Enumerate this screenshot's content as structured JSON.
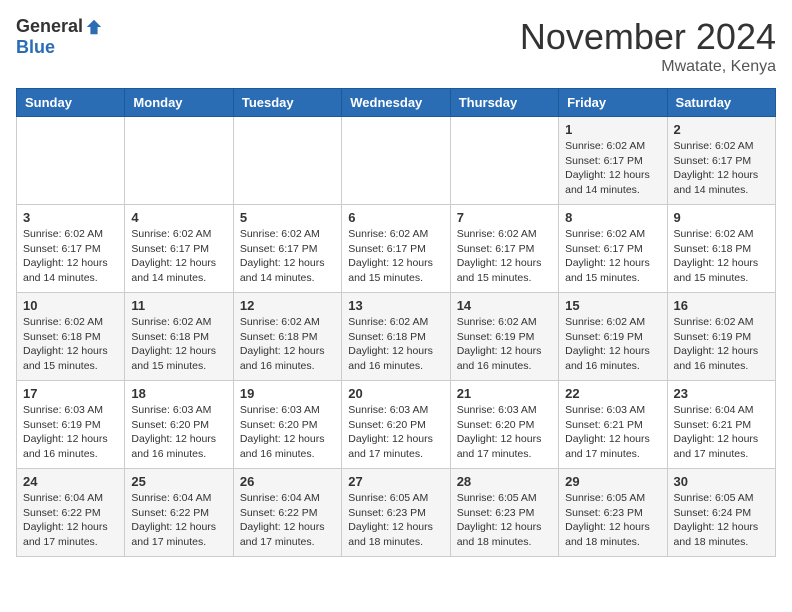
{
  "header": {
    "logo_general": "General",
    "logo_blue": "Blue",
    "month_title": "November 2024",
    "location": "Mwatate, Kenya"
  },
  "days_of_week": [
    "Sunday",
    "Monday",
    "Tuesday",
    "Wednesday",
    "Thursday",
    "Friday",
    "Saturday"
  ],
  "weeks": [
    [
      {
        "day": "",
        "info": ""
      },
      {
        "day": "",
        "info": ""
      },
      {
        "day": "",
        "info": ""
      },
      {
        "day": "",
        "info": ""
      },
      {
        "day": "",
        "info": ""
      },
      {
        "day": "1",
        "info": "Sunrise: 6:02 AM\nSunset: 6:17 PM\nDaylight: 12 hours\nand 14 minutes."
      },
      {
        "day": "2",
        "info": "Sunrise: 6:02 AM\nSunset: 6:17 PM\nDaylight: 12 hours\nand 14 minutes."
      }
    ],
    [
      {
        "day": "3",
        "info": "Sunrise: 6:02 AM\nSunset: 6:17 PM\nDaylight: 12 hours\nand 14 minutes."
      },
      {
        "day": "4",
        "info": "Sunrise: 6:02 AM\nSunset: 6:17 PM\nDaylight: 12 hours\nand 14 minutes."
      },
      {
        "day": "5",
        "info": "Sunrise: 6:02 AM\nSunset: 6:17 PM\nDaylight: 12 hours\nand 14 minutes."
      },
      {
        "day": "6",
        "info": "Sunrise: 6:02 AM\nSunset: 6:17 PM\nDaylight: 12 hours\nand 15 minutes."
      },
      {
        "day": "7",
        "info": "Sunrise: 6:02 AM\nSunset: 6:17 PM\nDaylight: 12 hours\nand 15 minutes."
      },
      {
        "day": "8",
        "info": "Sunrise: 6:02 AM\nSunset: 6:17 PM\nDaylight: 12 hours\nand 15 minutes."
      },
      {
        "day": "9",
        "info": "Sunrise: 6:02 AM\nSunset: 6:18 PM\nDaylight: 12 hours\nand 15 minutes."
      }
    ],
    [
      {
        "day": "10",
        "info": "Sunrise: 6:02 AM\nSunset: 6:18 PM\nDaylight: 12 hours\nand 15 minutes."
      },
      {
        "day": "11",
        "info": "Sunrise: 6:02 AM\nSunset: 6:18 PM\nDaylight: 12 hours\nand 15 minutes."
      },
      {
        "day": "12",
        "info": "Sunrise: 6:02 AM\nSunset: 6:18 PM\nDaylight: 12 hours\nand 16 minutes."
      },
      {
        "day": "13",
        "info": "Sunrise: 6:02 AM\nSunset: 6:18 PM\nDaylight: 12 hours\nand 16 minutes."
      },
      {
        "day": "14",
        "info": "Sunrise: 6:02 AM\nSunset: 6:19 PM\nDaylight: 12 hours\nand 16 minutes."
      },
      {
        "day": "15",
        "info": "Sunrise: 6:02 AM\nSunset: 6:19 PM\nDaylight: 12 hours\nand 16 minutes."
      },
      {
        "day": "16",
        "info": "Sunrise: 6:02 AM\nSunset: 6:19 PM\nDaylight: 12 hours\nand 16 minutes."
      }
    ],
    [
      {
        "day": "17",
        "info": "Sunrise: 6:03 AM\nSunset: 6:19 PM\nDaylight: 12 hours\nand 16 minutes."
      },
      {
        "day": "18",
        "info": "Sunrise: 6:03 AM\nSunset: 6:20 PM\nDaylight: 12 hours\nand 16 minutes."
      },
      {
        "day": "19",
        "info": "Sunrise: 6:03 AM\nSunset: 6:20 PM\nDaylight: 12 hours\nand 16 minutes."
      },
      {
        "day": "20",
        "info": "Sunrise: 6:03 AM\nSunset: 6:20 PM\nDaylight: 12 hours\nand 17 minutes."
      },
      {
        "day": "21",
        "info": "Sunrise: 6:03 AM\nSunset: 6:20 PM\nDaylight: 12 hours\nand 17 minutes."
      },
      {
        "day": "22",
        "info": "Sunrise: 6:03 AM\nSunset: 6:21 PM\nDaylight: 12 hours\nand 17 minutes."
      },
      {
        "day": "23",
        "info": "Sunrise: 6:04 AM\nSunset: 6:21 PM\nDaylight: 12 hours\nand 17 minutes."
      }
    ],
    [
      {
        "day": "24",
        "info": "Sunrise: 6:04 AM\nSunset: 6:22 PM\nDaylight: 12 hours\nand 17 minutes."
      },
      {
        "day": "25",
        "info": "Sunrise: 6:04 AM\nSunset: 6:22 PM\nDaylight: 12 hours\nand 17 minutes."
      },
      {
        "day": "26",
        "info": "Sunrise: 6:04 AM\nSunset: 6:22 PM\nDaylight: 12 hours\nand 17 minutes."
      },
      {
        "day": "27",
        "info": "Sunrise: 6:05 AM\nSunset: 6:23 PM\nDaylight: 12 hours\nand 18 minutes."
      },
      {
        "day": "28",
        "info": "Sunrise: 6:05 AM\nSunset: 6:23 PM\nDaylight: 12 hours\nand 18 minutes."
      },
      {
        "day": "29",
        "info": "Sunrise: 6:05 AM\nSunset: 6:23 PM\nDaylight: 12 hours\nand 18 minutes."
      },
      {
        "day": "30",
        "info": "Sunrise: 6:05 AM\nSunset: 6:24 PM\nDaylight: 12 hours\nand 18 minutes."
      }
    ]
  ]
}
